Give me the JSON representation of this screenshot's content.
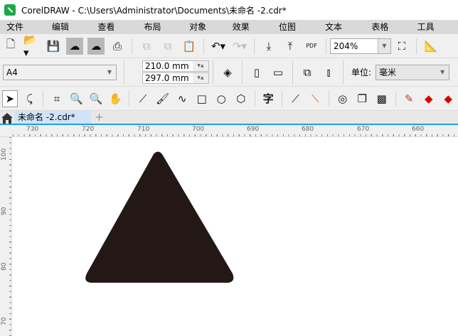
{
  "window": {
    "title": "CorelDRAW - C:\\Users\\Administrator\\Documents\\未命名 -2.cdr*"
  },
  "menu": [
    "文件(F)",
    "编辑(E)",
    "查看(V)",
    "布局(L)",
    "对象(J)",
    "效果(C)",
    "位图(B)",
    "文本(X)",
    "表格(T)",
    "工具(O)"
  ],
  "toolbar": {
    "pdf_label": "PDF",
    "zoom_value": "204%"
  },
  "property_bar": {
    "page_size": "A4",
    "width": "210.0 mm",
    "height": "297.0 mm",
    "units_label": "单位:",
    "units_value": "毫米"
  },
  "toolbox": {
    "text_tool_glyph": "字"
  },
  "tabs": {
    "document": "未命名 -2.cdr*",
    "new_tab": "+"
  },
  "rulers": {
    "horizontal": [
      "730",
      "720",
      "710",
      "700",
      "690",
      "680",
      "670",
      "660"
    ],
    "vertical": [
      "100",
      "90",
      "80",
      "70"
    ]
  },
  "shape": {
    "type": "rounded-triangle",
    "fill": "#231815"
  }
}
